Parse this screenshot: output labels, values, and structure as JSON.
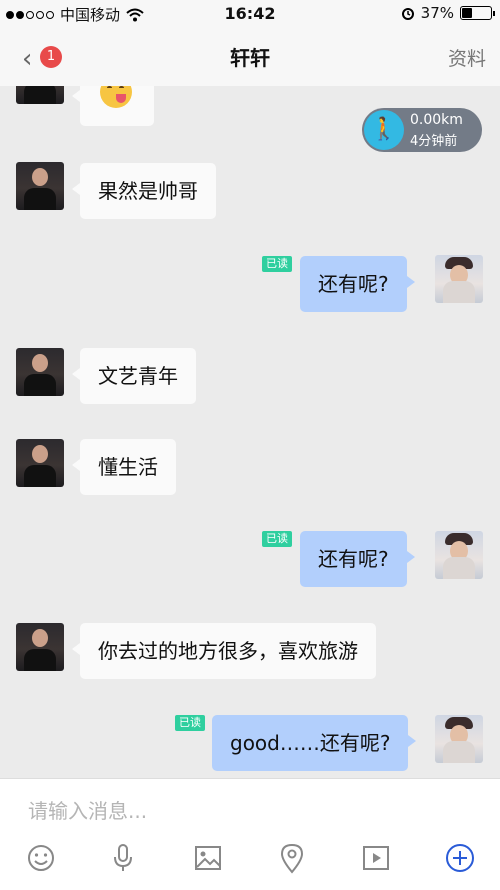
{
  "status_bar": {
    "carrier": "中国移动",
    "time": "16:42",
    "battery": "37%",
    "battery_level": 0.37
  },
  "nav": {
    "badge_count": "1",
    "title": "轩轩",
    "right_label": "资料"
  },
  "location_card": {
    "distance": "0.00km",
    "time_ago": "4分钟前"
  },
  "messages": [
    {
      "direction": "in",
      "text": "果然是帅哥"
    },
    {
      "direction": "out",
      "text": "还有呢?",
      "read_label": "已读"
    },
    {
      "direction": "in",
      "text": "文艺青年"
    },
    {
      "direction": "in",
      "text": "懂生活"
    },
    {
      "direction": "out",
      "text": "还有呢?",
      "read_label": "已读"
    },
    {
      "direction": "in",
      "text": "你去过的地方很多，喜欢旅游"
    },
    {
      "direction": "out",
      "text": "good……还有呢?",
      "read_label": "已读"
    }
  ],
  "input": {
    "placeholder": "请输入消息..."
  },
  "toolbar": {
    "icons": [
      "emoji-icon",
      "microphone-icon",
      "image-icon",
      "location-pin-icon",
      "video-icon",
      "plus-icon"
    ],
    "accent_color": "#2a5bd7"
  }
}
